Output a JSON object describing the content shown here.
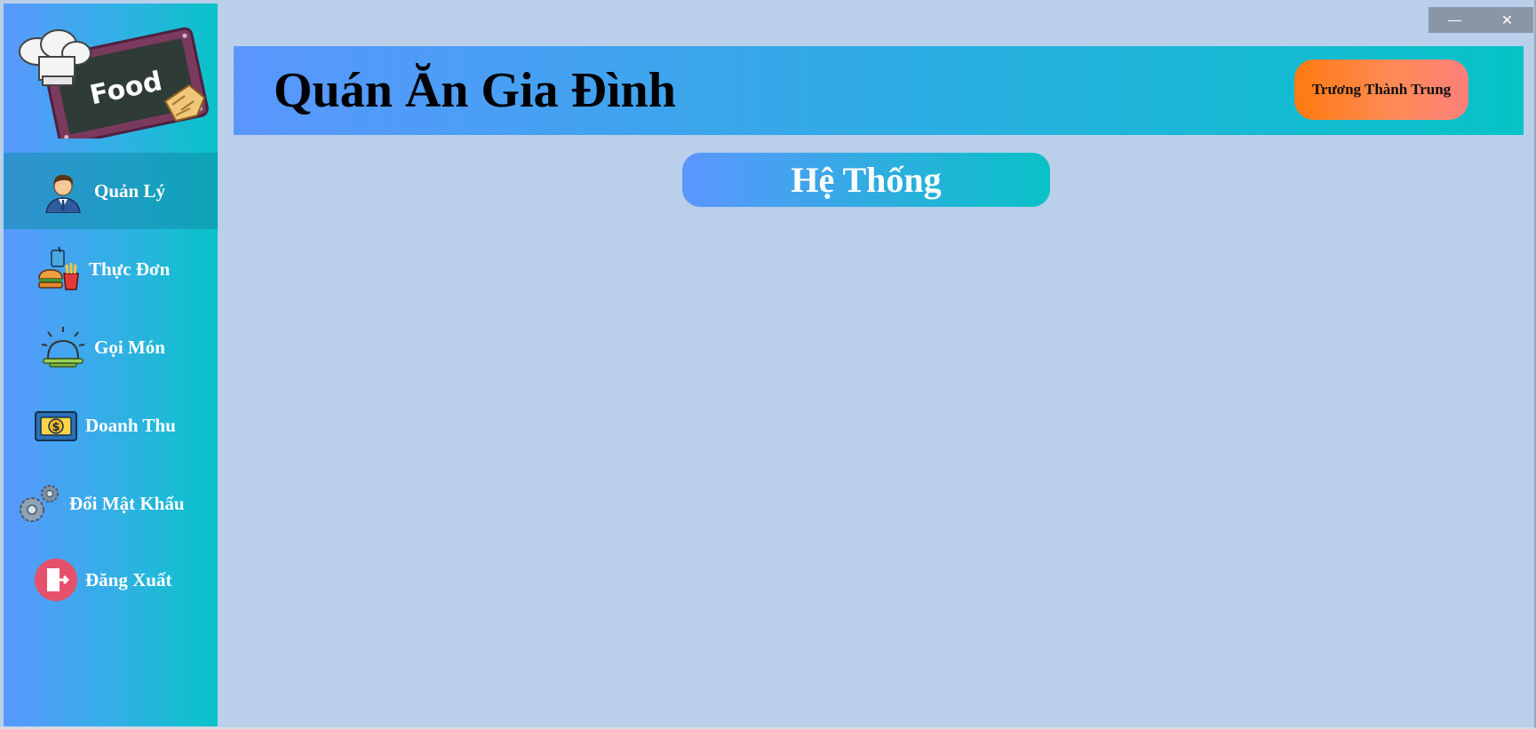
{
  "window": {
    "minimize_glyph": "—",
    "close_glyph": "✕"
  },
  "brand": {
    "logo_text": "Food"
  },
  "header": {
    "title": "Quán Ăn Gia Đình",
    "user_name": "Trương Thành Trung"
  },
  "main": {
    "section_title": "Hệ Thống"
  },
  "sidebar": {
    "items": [
      {
        "label": "Quản Lý",
        "icon": "manager-icon",
        "active": true
      },
      {
        "label": "Thực Đơn",
        "icon": "menu-food-icon",
        "active": false
      },
      {
        "label": "Gọi Món",
        "icon": "service-bell-icon",
        "active": false
      },
      {
        "label": "Doanh Thu",
        "icon": "money-icon",
        "active": false
      },
      {
        "label": "Đổi Mật Khẩu",
        "icon": "gears-icon",
        "active": false
      },
      {
        "label": "Đăng Xuất",
        "icon": "logout-icon",
        "active": false
      }
    ]
  },
  "colors": {
    "background": "#b9cfea",
    "gradient_start": "#5b96ff",
    "gradient_end": "#05c3c6",
    "user_badge": "#ff7a10"
  }
}
